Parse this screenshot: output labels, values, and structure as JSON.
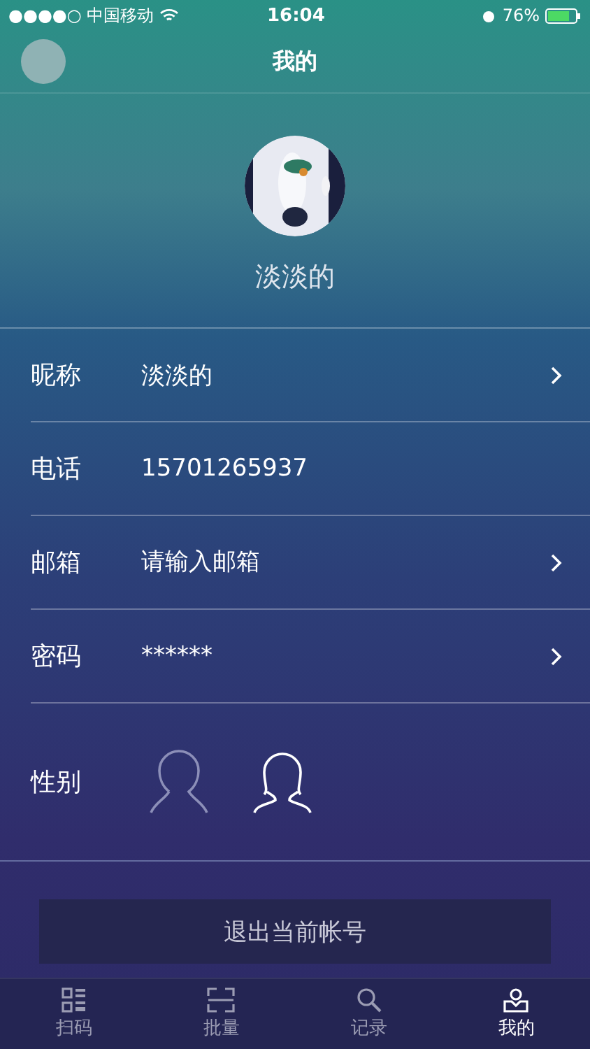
{
  "status_bar": {
    "carrier": "●●●●○ 中国移动",
    "time": "16:04",
    "battery": "76%"
  },
  "nav": {
    "title": "我的"
  },
  "profile": {
    "name": "淡淡的"
  },
  "fields": [
    {
      "label": "昵称",
      "value": "淡淡的",
      "kind": "value",
      "arrow": true
    },
    {
      "label": "电话",
      "value": "15701265937",
      "kind": "value",
      "arrow": false
    },
    {
      "label": "邮箱",
      "placeholder": "请输入邮箱",
      "kind": "input",
      "arrow": true
    },
    {
      "label": "密码",
      "value": "******",
      "kind": "value",
      "arrow": true
    }
  ],
  "gender": {
    "label": "性别",
    "options": [
      {
        "kind": "male",
        "selected": false
      },
      {
        "kind": "female",
        "selected": true
      }
    ]
  },
  "logout_button": "退出当前帐号",
  "tabs": [
    {
      "label": "扫码",
      "kind": "qr",
      "selected": false
    },
    {
      "label": "批量",
      "kind": "scan",
      "selected": false
    },
    {
      "label": "记录",
      "kind": "search",
      "selected": false
    },
    {
      "label": "我的",
      "kind": "user",
      "selected": true
    }
  ]
}
